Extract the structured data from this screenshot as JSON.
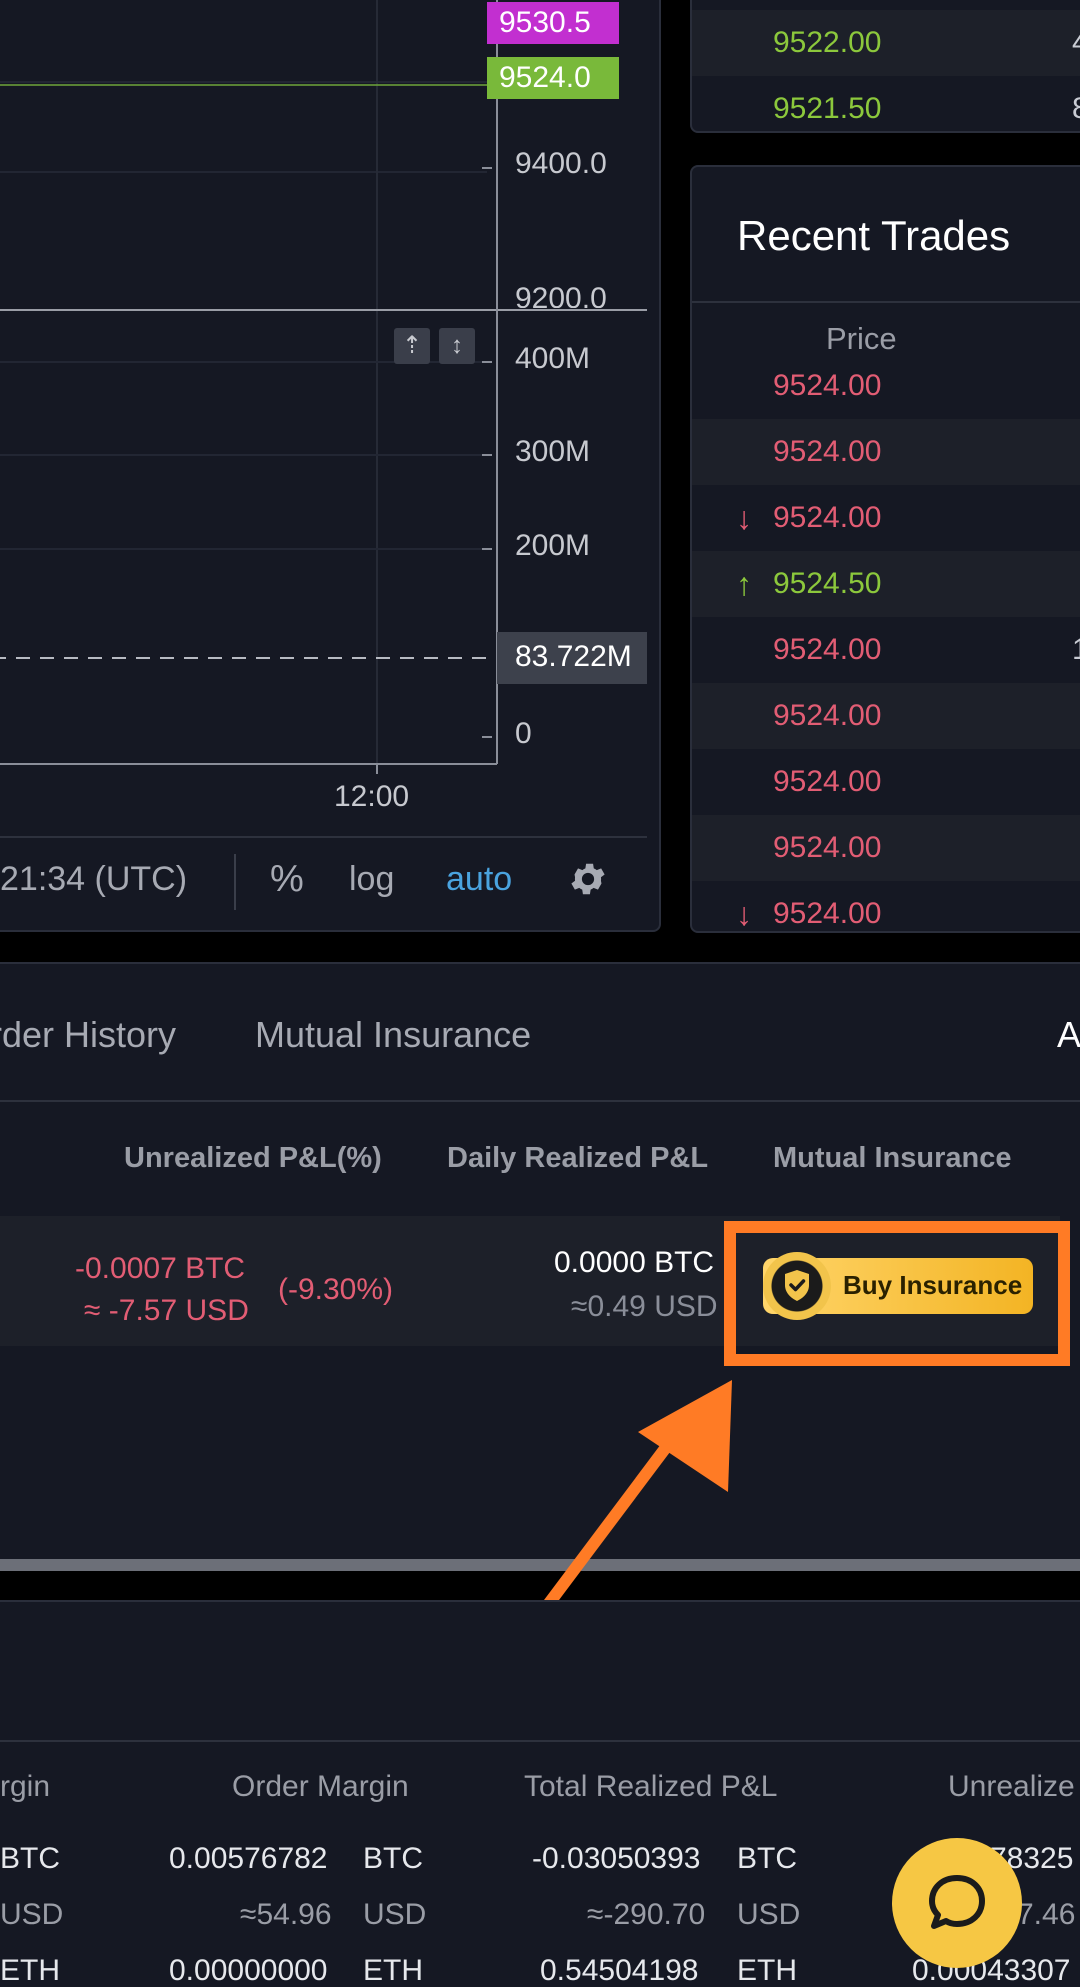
{
  "chart": {
    "price_tags": [
      {
        "label": "9530.5",
        "color": "#c22fd0"
      },
      {
        "label": "9524.0",
        "color": "#79b93a"
      }
    ],
    "price_axis": [
      "9400.0",
      "9200.0"
    ],
    "volume_axis": [
      "400M",
      "300M",
      "200M",
      "83.722M",
      "0"
    ],
    "time_label": "12:00",
    "footer": {
      "time": "21:34 (UTC)",
      "percent": "%",
      "log": "log",
      "auto": "auto"
    }
  },
  "order_book": {
    "rows": [
      {
        "price": "9522.00",
        "qty": "4"
      },
      {
        "price": "9521.50",
        "qty": "8"
      }
    ]
  },
  "recent_trades": {
    "title": "Recent Trades",
    "price_header": "Price",
    "rows": [
      {
        "price": "9524.00",
        "dir": "",
        "side": "sell"
      },
      {
        "price": "9524.00",
        "dir": "",
        "side": "sell"
      },
      {
        "price": "9524.00",
        "dir": "↓",
        "side": "sell"
      },
      {
        "price": "9524.50",
        "dir": "↑",
        "side": "buy"
      },
      {
        "price": "9524.00",
        "dir": "",
        "side": "sell",
        "qty": "1"
      },
      {
        "price": "9524.00",
        "dir": "",
        "side": "sell"
      },
      {
        "price": "9524.00",
        "dir": "",
        "side": "sell"
      },
      {
        "price": "9524.00",
        "dir": "",
        "side": "sell"
      },
      {
        "price": "9524.00",
        "dir": "↓",
        "side": "sell"
      }
    ]
  },
  "positions": {
    "tabs": [
      "rder History",
      "Mutual Insurance",
      "A"
    ],
    "columns": [
      "Unrealized P&L(%)",
      "Daily Realized P&L",
      "Mutual Insurance"
    ],
    "row": {
      "unrealized_btc": "-0.0007 BTC",
      "unrealized_usd": "≈ -7.57 USD",
      "unrealized_pct": "(-9.30%)",
      "daily_btc": "0.0000 BTC",
      "daily_usd": "≈0.49 USD",
      "insurance_button": "Buy Insurance"
    }
  },
  "balances": {
    "headers": [
      "rgin",
      "Order Margin",
      "Total Realized P&L",
      "Unrealize"
    ],
    "rows": [
      {
        "c0": "BTC",
        "margin": "0.00576782",
        "margin_unit": "BTC",
        "realized": "-0.03050393",
        "realized_unit": "BTC",
        "unrealized": "78325"
      },
      {
        "c0": "USD",
        "margin": "≈54.96",
        "margin_unit": "USD",
        "realized": "≈-290.70",
        "realized_unit": "USD",
        "unrealized": "7.46"
      },
      {
        "c0": "ETH",
        "margin": "0.00000000",
        "margin_unit": "ETH",
        "realized": "0.54504198",
        "realized_unit": "ETH",
        "unrealized": "0.00043307"
      }
    ]
  },
  "colors": {
    "highlight": "#ff7b25",
    "accent_blue": "#4aa3df",
    "sell": "#e25d74",
    "buy": "#8cc83c",
    "fab": "#f6c744"
  }
}
